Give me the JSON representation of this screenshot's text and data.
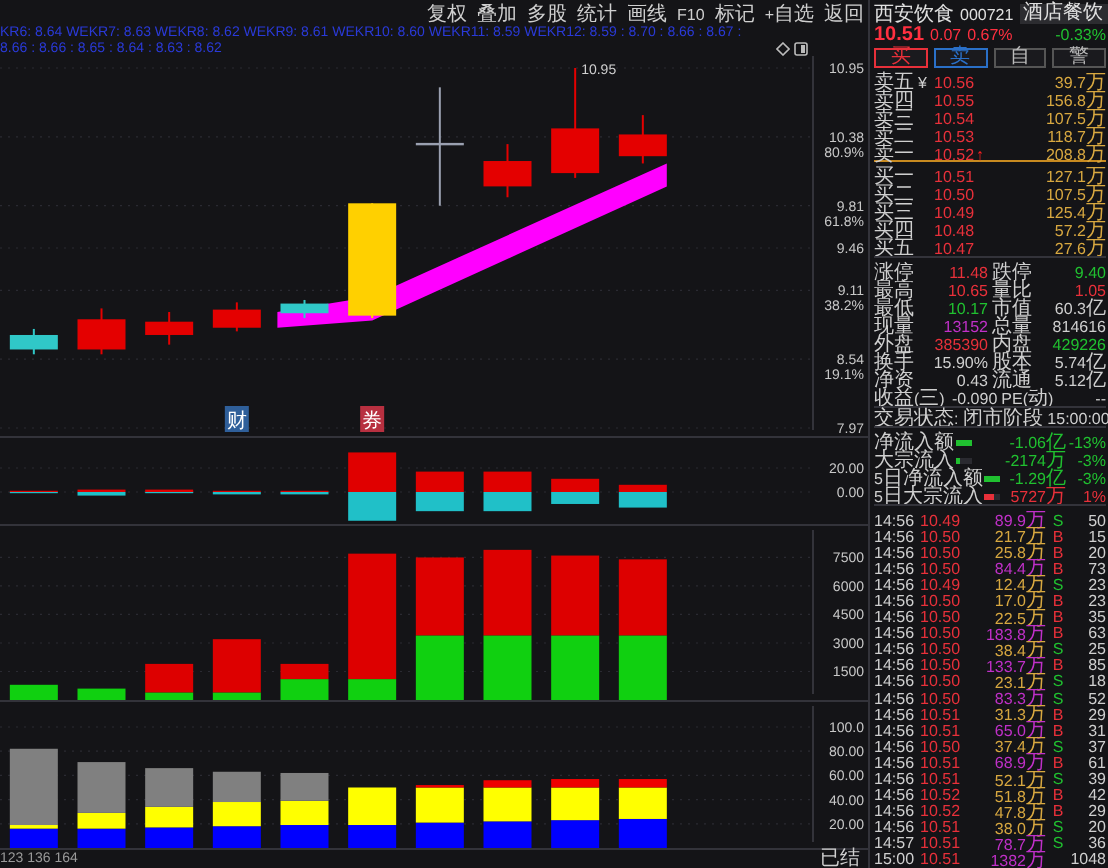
{
  "toolbar": {
    "buttons": [
      "复权",
      "叠加",
      "多股",
      "统计",
      "画线",
      "F10",
      "标记",
      "+自选",
      "返回"
    ]
  },
  "indicator_line": "KR6: 8.64 WEKR7: 8.63 WEKR8: 8.62 WEKR9: 8.61 WEKR10: 8.60 WEKR11: 8.59 WEKR12: 8.59 : 8.70 : 8.66 : 8.67 : 8.66 : 8.66 : 8.65 : 8.64 : 8.63 : 8.62",
  "price_chart": {
    "axis": [
      {
        "price": "10.95"
      },
      {
        "price": "10.38",
        "percent": "80.9%"
      },
      {
        "price": "9.81",
        "percent": "61.8%"
      },
      {
        "price": "9.46"
      },
      {
        "price": "9.11",
        "percent": "38.2%"
      },
      {
        "price": "8.54",
        "percent": "19.1%"
      },
      {
        "price": "7.97"
      }
    ],
    "high_marker": "10.95",
    "markers": [
      {
        "label": "财",
        "kind": "finance"
      },
      {
        "label": "券",
        "kind": "margin"
      }
    ]
  },
  "indicator_panel": {
    "chart_data": {
      "type": "bar",
      "stacked": true,
      "grid": true,
      "ylim": [
        -26.7,
        46.7
      ],
      "yticks": [
        {
          "value": 0,
          "label": "0.00"
        },
        {
          "value": 20,
          "label": "20.00"
        }
      ],
      "series": [
        {
          "color": "#e00000",
          "values": [
            1,
            2,
            2,
            1,
            1,
            33,
            17,
            17,
            11,
            6,
            null,
            null
          ]
        },
        {
          "color": "#20c0c8",
          "values": [
            -1,
            -3,
            -1,
            -2,
            -2,
            -24,
            -16,
            -16,
            -10,
            -13,
            null,
            null
          ]
        }
      ]
    }
  },
  "volume_panel": {
    "chart_data": {
      "type": "bar",
      "stacked": true,
      "grid": true,
      "ylim": [
        0,
        9260
      ],
      "yticks": [
        1500,
        3000,
        4500,
        6000,
        7500
      ],
      "series": [
        {
          "color": "#10d010",
          "values": [
            800,
            600,
            400,
            400,
            1100,
            1100,
            3400,
            3400,
            3400,
            3400,
            null,
            null
          ]
        },
        {
          "color": "#dd0000",
          "values": [
            0,
            0,
            1500,
            2800,
            800,
            6600,
            4100,
            4500,
            4200,
            4000,
            null,
            null
          ]
        }
      ]
    }
  },
  "ratio_panel": {
    "chart_data": {
      "type": "bar",
      "stacked": true,
      "grid": true,
      "ylim": [
        0,
        122.3
      ],
      "yticks": [
        {
          "value": 20,
          "label": "20.00"
        },
        {
          "value": 40,
          "label": "40.00"
        },
        {
          "value": 60,
          "label": "60.00"
        },
        {
          "value": 80,
          "label": "80.00"
        },
        {
          "value": 100,
          "label": "100.0"
        }
      ],
      "series": [
        {
          "color": "#0000ff",
          "values": [
            16,
            16,
            17,
            18,
            19,
            19,
            21,
            22,
            23,
            24,
            null,
            null
          ]
        },
        {
          "color": "#ffff00",
          "values": [
            3,
            13,
            17,
            20,
            20,
            31,
            29,
            28,
            27,
            26,
            null,
            null
          ]
        },
        {
          "color": "#ee0000",
          "values": [
            0,
            0,
            0,
            0,
            0,
            0,
            2,
            6,
            7,
            7,
            null,
            null
          ]
        },
        {
          "color": "#808080",
          "values": [
            63,
            42,
            32,
            25,
            23,
            0,
            0,
            0,
            0,
            0,
            null,
            null
          ]
        }
      ]
    }
  },
  "footer": {
    "left": "123 136 164",
    "right": "已结"
  },
  "quote": {
    "name": "西安饮食",
    "code": "000721",
    "sector": "酒店餐饮",
    "price": "10.51",
    "change": "0.07",
    "change_pct": "0.67%",
    "sector_change": "-0.33%"
  },
  "actions": [
    {
      "label": "买",
      "kind": "buy"
    },
    {
      "label": "卖",
      "kind": "sell"
    },
    {
      "label": "自",
      "kind": "plain"
    },
    {
      "label": "警",
      "kind": "plain"
    }
  ],
  "order_book": {
    "asks": [
      {
        "label": "卖五",
        "label_mark": "¥",
        "price": "10.56",
        "volume": "39.7万"
      },
      {
        "label": "卖四",
        "price": "10.55",
        "volume": "156.8万"
      },
      {
        "label": "卖三",
        "price": "10.54",
        "volume": "107.5万"
      },
      {
        "label": "卖二",
        "price": "10.53",
        "volume": "118.7万"
      },
      {
        "label": "卖一",
        "price": "10.52",
        "price_mark": "↑",
        "volume": "208.8万"
      }
    ],
    "bids": [
      {
        "label": "买一",
        "price": "10.51",
        "volume": "127.1万"
      },
      {
        "label": "买二",
        "price": "10.50",
        "volume": "107.5万"
      },
      {
        "label": "买三",
        "price": "10.49",
        "volume": "125.4万"
      },
      {
        "label": "买四",
        "price": "10.48",
        "volume": "57.2万"
      },
      {
        "label": "买五",
        "price": "10.47",
        "volume": "27.6万"
      }
    ]
  },
  "stats": [
    {
      "cells": [
        {
          "label": "涨停",
          "value": "11.48",
          "color": "#e8303a"
        },
        {
          "label": "跌停",
          "value": "9.40",
          "color": "#20c030"
        }
      ]
    },
    {
      "cells": [
        {
          "label": "最高",
          "value": "10.65",
          "color": "#e8303a"
        },
        {
          "label": "量比",
          "value": "1.05",
          "color": "#e8303a"
        }
      ]
    },
    {
      "cells": [
        {
          "label": "最低",
          "value": "10.17",
          "color": "#20c030"
        },
        {
          "label": "市值",
          "value": "60.3亿"
        }
      ]
    },
    {
      "cells": [
        {
          "label": "现量",
          "value": "13152",
          "color": "#c030c8"
        },
        {
          "label": "总量",
          "value": "814616"
        }
      ]
    },
    {
      "cells": [
        {
          "label": "外盘",
          "value": "385390",
          "color": "#e8303a"
        },
        {
          "label": "内盘",
          "value": "429226",
          "color": "#20c030"
        }
      ]
    },
    {
      "cells": [
        {
          "label": "换手",
          "value": "15.90%"
        },
        {
          "label": "股本",
          "value": "5.74亿"
        }
      ]
    },
    {
      "cells": [
        {
          "label": "净资",
          "value": "0.43"
        },
        {
          "label": "流通",
          "value": "5.12亿"
        }
      ]
    },
    {
      "cells": [
        {
          "label": "收益(三)",
          "value": "-0.090"
        },
        {
          "label": "PE(动)",
          "value": "--"
        }
      ]
    }
  ],
  "status": "交易状态: 闭市阶段 15:00:00",
  "flows": [
    {
      "label": "净流入额",
      "level": 1,
      "color": "#20c030",
      "amount": "-1.06亿",
      "pct": "-13%"
    },
    {
      "label": "大宗流入",
      "level": 0.2,
      "color": "#20c030",
      "amount": "-2174万",
      "pct": "-3%"
    },
    {
      "label": "5日净流入额",
      "level": 1,
      "color": "#20c030",
      "amount": "-1.29亿",
      "pct": "-3%"
    },
    {
      "label": "5日大宗流入",
      "level": 0.6,
      "color": "#e8303a",
      "amount": "5727万",
      "pct": "1%"
    }
  ],
  "ticks": [
    {
      "time": "14:56",
      "price": "10.49",
      "amount": "89.9万",
      "color": "#c030c8",
      "side": "S",
      "kind": "sell",
      "count": "50"
    },
    {
      "time": "14:56",
      "price": "10.50",
      "amount": "21.7万",
      "color": "#d8a840",
      "side": "B",
      "kind": "buy",
      "count": "15"
    },
    {
      "time": "14:56",
      "price": "10.50",
      "amount": "25.8万",
      "color": "#d8a840",
      "side": "B",
      "kind": "buy",
      "count": "20"
    },
    {
      "time": "14:56",
      "price": "10.50",
      "amount": "84.4万",
      "color": "#c030c8",
      "side": "B",
      "kind": "buy",
      "count": "73"
    },
    {
      "time": "14:56",
      "price": "10.49",
      "amount": "12.4万",
      "color": "#d8a840",
      "side": "S",
      "kind": "sell",
      "count": "23"
    },
    {
      "time": "14:56",
      "price": "10.50",
      "amount": "17.0万",
      "color": "#d8a840",
      "side": "B",
      "kind": "buy",
      "count": "23"
    },
    {
      "time": "14:56",
      "price": "10.50",
      "amount": "22.5万",
      "color": "#d8a840",
      "side": "B",
      "kind": "buy",
      "count": "35"
    },
    {
      "time": "14:56",
      "price": "10.50",
      "amount": "183.8万",
      "color": "#c030c8",
      "side": "B",
      "kind": "buy",
      "count": "63"
    },
    {
      "time": "14:56",
      "price": "10.50",
      "amount": "38.4万",
      "color": "#d8a840",
      "side": "S",
      "kind": "sell",
      "count": "25"
    },
    {
      "time": "14:56",
      "price": "10.50",
      "amount": "133.7万",
      "color": "#c030c8",
      "side": "B",
      "kind": "buy",
      "count": "85"
    },
    {
      "time": "14:56",
      "price": "10.50",
      "amount": "23.1万",
      "color": "#d8a840",
      "side": "S",
      "kind": "sell",
      "count": "18"
    },
    {
      "time": "14:56",
      "price": "10.50",
      "amount": "83.3万",
      "color": "#c030c8",
      "side": "S",
      "kind": "sell",
      "count": "52"
    },
    {
      "time": "14:56",
      "price": "10.51",
      "amount": "31.3万",
      "color": "#d8a840",
      "side": "B",
      "kind": "buy",
      "count": "29"
    },
    {
      "time": "14:56",
      "price": "10.51",
      "amount": "65.0万",
      "color": "#c030c8",
      "side": "B",
      "kind": "buy",
      "count": "31"
    },
    {
      "time": "14:56",
      "price": "10.50",
      "amount": "37.4万",
      "color": "#d8a840",
      "side": "S",
      "kind": "sell",
      "count": "37"
    },
    {
      "time": "14:56",
      "price": "10.51",
      "amount": "68.9万",
      "color": "#c030c8",
      "side": "B",
      "kind": "buy",
      "count": "61"
    },
    {
      "time": "14:56",
      "price": "10.51",
      "amount": "52.1万",
      "color": "#d8a840",
      "side": "S",
      "kind": "sell",
      "count": "39"
    },
    {
      "time": "14:56",
      "price": "10.52",
      "amount": "51.8万",
      "color": "#d8a840",
      "side": "B",
      "kind": "buy",
      "count": "42"
    },
    {
      "time": "14:56",
      "price": "10.52",
      "amount": "47.8万",
      "color": "#d8a840",
      "side": "B",
      "kind": "buy",
      "count": "29"
    },
    {
      "time": "14:56",
      "price": "10.51",
      "amount": "38.0万",
      "color": "#d8a840",
      "side": "S",
      "kind": "sell",
      "count": "20"
    },
    {
      "time": "14:57",
      "price": "10.51",
      "amount": "78.7万",
      "color": "#c030c8",
      "side": "S",
      "kind": "sell",
      "count": "36"
    },
    {
      "time": "15:00",
      "price": "10.51",
      "amount": "1382万",
      "color": "#c030c8",
      "count": "1048"
    }
  ]
}
